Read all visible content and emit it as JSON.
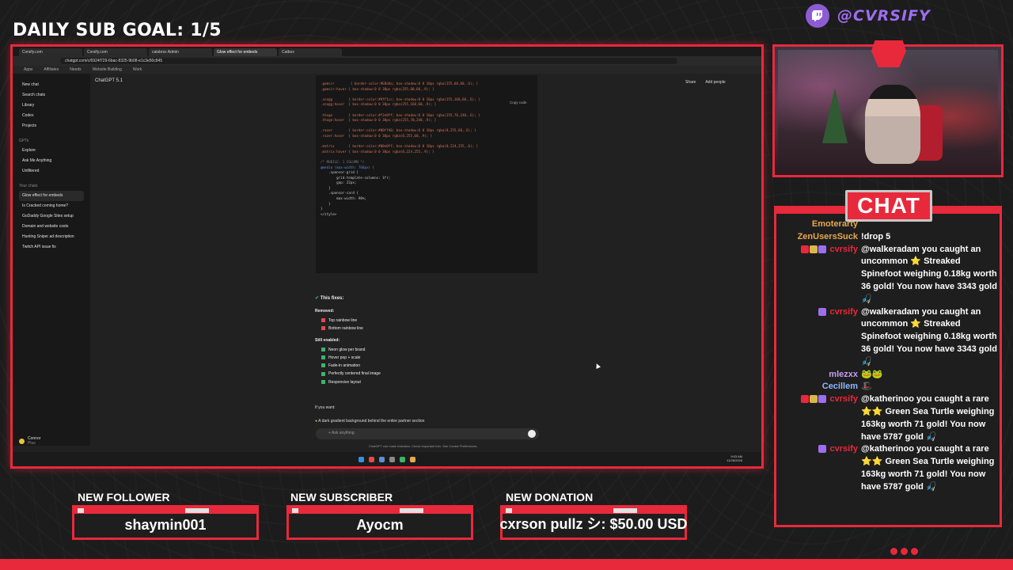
{
  "overlay": {
    "goal": "DAILY SUB GOAL: 1/5",
    "handle": "@CVRSIFY",
    "chat_title": "CHAT",
    "alerts": [
      {
        "label": "NEW FOLLOWER",
        "value": "shaymin001"
      },
      {
        "label": "NEW SUBSCRIBER",
        "value": "Ayocm"
      },
      {
        "label": "NEW DONATION",
        "value": "cxrson pullz シ: $50.00 USD"
      }
    ],
    "accent": "#e8293b",
    "brand_color": "#9d6ef0"
  },
  "browser": {
    "tabs": [
      "Cvrsify.com",
      "Cvrsify.com",
      "catsbrsx Admin",
      "Glow effect for embeds",
      "Catbox"
    ],
    "active_tab": 3,
    "url": "chatgpt.com/c/6924f729-6bac-8325-9b08-e1c3e50c845",
    "bookmarks": [
      "Apps",
      "Affiliates",
      "Needs",
      "Website Building",
      "Work"
    ]
  },
  "chatgpt": {
    "sidebar": {
      "items": [
        "New chat",
        "Search chats",
        "Library",
        "Codex",
        "Projects"
      ],
      "gpts_head": "GPTs",
      "gpts": [
        "Explore",
        "Ask Me Anything",
        "Unfiltered"
      ],
      "chats_head": "Your chats",
      "chats": [
        "Glow effect for embeds",
        "Is Cracked coming home?",
        "GoDaddy Google Sites setup",
        "Domain and website costs",
        "Hunting Sniper ad description",
        "Twitch API issue fix"
      ],
      "user": "Connor",
      "plan": "Plus"
    },
    "model": "ChatGPT 5.1",
    "share": "Share",
    "add_people": "Add people",
    "copy_code": "Copy code",
    "code_lines": [
      ".gemsir        { border-color:#E8d4a; box-shadow:0 0 10px rgba(255,60,60,.6); }",
      ".gamsir:hover { box-shadow:0 0 30px rgba(255,60,60,.9); }",
      "",
      ".snagg        { border-color:#9ff1cc; box-shadow:0 0 10px rgba(255,160,60,.6); }",
      ".snagg:hover  { box-shadow:0 0 30px rgba(255,160,60,.9); }",
      "",
      ".thoge        { border-color:#f2e8ff; box-shadow:0 0 10px rgba(255,70,240,.6); }",
      ".thoge:hover  { box-shadow:0 0 30px rgba(255,70,240,.9); }",
      "",
      ".razer        { border-color:#00ff40; box-shadow:0 0 10px rgba(0,255,60,.6); }",
      ".razer:hover  { box-shadow:0 0 30px rgba(0,255,60,.9); }",
      "",
      ".matrix       { border-color:#00e0ff; box-shadow:0 0 10px rgba(0,224,255,.6); }",
      ".matrix:hover { box-shadow:0 0 30px rgba(0,224,255,.9); }",
      "",
      "/* MOBILE: 1 COLUMN */",
      "@media (max-width: 768px) {",
      "    .sponsor-grid {",
      "        grid-template-columns: 1fr;",
      "        gap: 22px;",
      "    }",
      "    .sponsor-card {",
      "        max-width: 90%;",
      "    }",
      "}",
      "</style>"
    ],
    "fixes_title": "This fixes:",
    "removed_head": "Removed:",
    "removed": [
      "Top rainbow line",
      "Bottom rainbow line"
    ],
    "enabled_head": "Still enabled:",
    "enabled": [
      "Neon glow per brand",
      "Hover pop + scale",
      "Fade-in animation",
      "Perfectly centered final image",
      "Responsive layout"
    ],
    "if_you_want": "If you want:",
    "gradient_note": "A dark gradient background behind the entire partner section",
    "ask_placeholder": "Ask anything",
    "disclaimer": "ChatGPT can make mistakes. Check important info. See Cookie Preferences.",
    "clock_time": "9:03 AM",
    "clock_date": "11/26/2025"
  },
  "chat": {
    "messages": [
      {
        "name": "Emoterarty",
        "name_color": "#e7a84e",
        "badges": [],
        "text": ""
      },
      {
        "name": "ZenUsersSuck",
        "name_color": "#e7a84e",
        "badges": [],
        "text": "!drop 5"
      },
      {
        "name": "cvrsify",
        "name_color": "#e8293b",
        "badges": [
          "#e8293b",
          "#d9b84a",
          "#9d6ef0"
        ],
        "text": "@walkeradam you caught an uncommon ⭐ Streaked Spinefoot weighing 0.18kg worth 36 gold! You now have 3343 gold 🎣"
      },
      {
        "name": "cvrsify",
        "name_color": "#e8293b",
        "badges": [
          "#9d6ef0"
        ],
        "text": "@walkeradam you caught an uncommon ⭐ Streaked Spinefoot weighing 0.18kg worth 36 gold! You now have 3343 gold 🎣"
      },
      {
        "name": "mlezxx",
        "name_color": "#c79cf0",
        "badges": [],
        "text": "🐸🐸"
      },
      {
        "name": "Cecillem",
        "name_color": "#8fb7ff",
        "badges": [],
        "text": "🎩"
      },
      {
        "name": "cvrsify",
        "name_color": "#e8293b",
        "badges": [
          "#e8293b",
          "#d9b84a",
          "#9d6ef0"
        ],
        "text": "@katherinoo you caught a rare ⭐⭐ Green Sea Turtle weighing 163kg worth 71 gold! You now have 5787 gold 🎣"
      },
      {
        "name": "cvrsify",
        "name_color": "#e8293b",
        "badges": [
          "#9d6ef0"
        ],
        "text": "@katherinoo you caught a rare ⭐⭐ Green Sea Turtle weighing 163kg worth 71 gold! You now have 5787 gold 🎣"
      }
    ]
  }
}
